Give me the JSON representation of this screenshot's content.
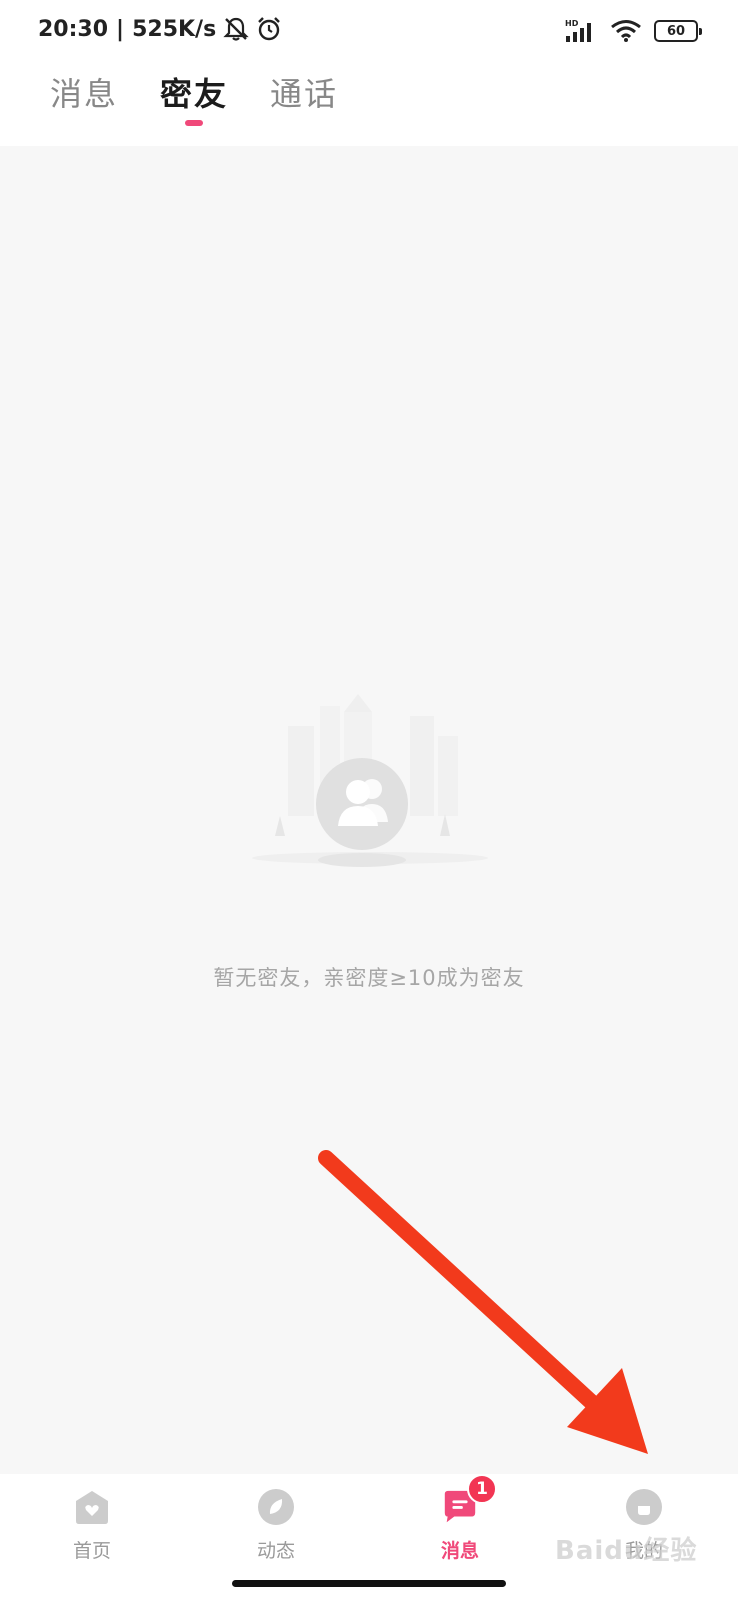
{
  "status_bar": {
    "time": "20:30",
    "separator": "|",
    "net_speed": "525K/s",
    "battery": "60",
    "network_label": "HD"
  },
  "header": {
    "tabs": [
      {
        "label": "消息",
        "active": false
      },
      {
        "label": "密友",
        "active": true
      },
      {
        "label": "通话",
        "active": false
      }
    ]
  },
  "main": {
    "empty_text": "暂无密友，亲密度≥10成为密友",
    "empty_icon": "friends-icon"
  },
  "bottom_nav": {
    "items": [
      {
        "label": "首页",
        "icon": "home-icon"
      },
      {
        "label": "动态",
        "icon": "leaf-icon"
      },
      {
        "label": "消息",
        "icon": "message-icon",
        "badge": "1",
        "active": true
      },
      {
        "label": "我的",
        "icon": "profile-icon"
      }
    ]
  },
  "colors": {
    "accent": "#f0497a",
    "badge": "#f23553",
    "arrow": "#f23a1c",
    "background": "#f7f7f7"
  },
  "watermark": "Baidu经验"
}
